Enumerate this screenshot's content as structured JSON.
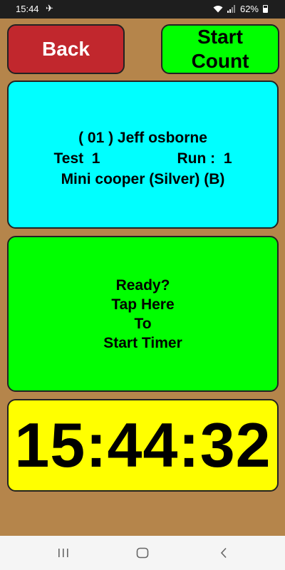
{
  "status_bar": {
    "time": "15:44",
    "battery": "62%",
    "icons": [
      "airplane-icon",
      "wifi-icon",
      "signal-icon",
      "battery-icon"
    ]
  },
  "header": {
    "back_label": "Back",
    "start_count_line1": "Start",
    "start_count_line2": "Count"
  },
  "info": {
    "driver": "( 01 ) Jeff osborne",
    "test_label": "Test  1",
    "run_label": "Run :  1",
    "car": "Mini cooper (Silver) (B)"
  },
  "start_timer": {
    "line1": "Ready?",
    "line2": "Tap Here",
    "line3": "To",
    "line4": "Start Timer"
  },
  "clock": {
    "time": "15:44:32"
  },
  "nav_bar": {
    "buttons": [
      "recents-icon",
      "home-icon",
      "back-nav-icon"
    ]
  },
  "colors": {
    "background": "#b5854b",
    "back_button": "#c1272d",
    "start_count_button": "#00ff00",
    "info_panel": "#00ffff",
    "start_timer_panel": "#00ff00",
    "clock_panel": "#ffff00"
  }
}
